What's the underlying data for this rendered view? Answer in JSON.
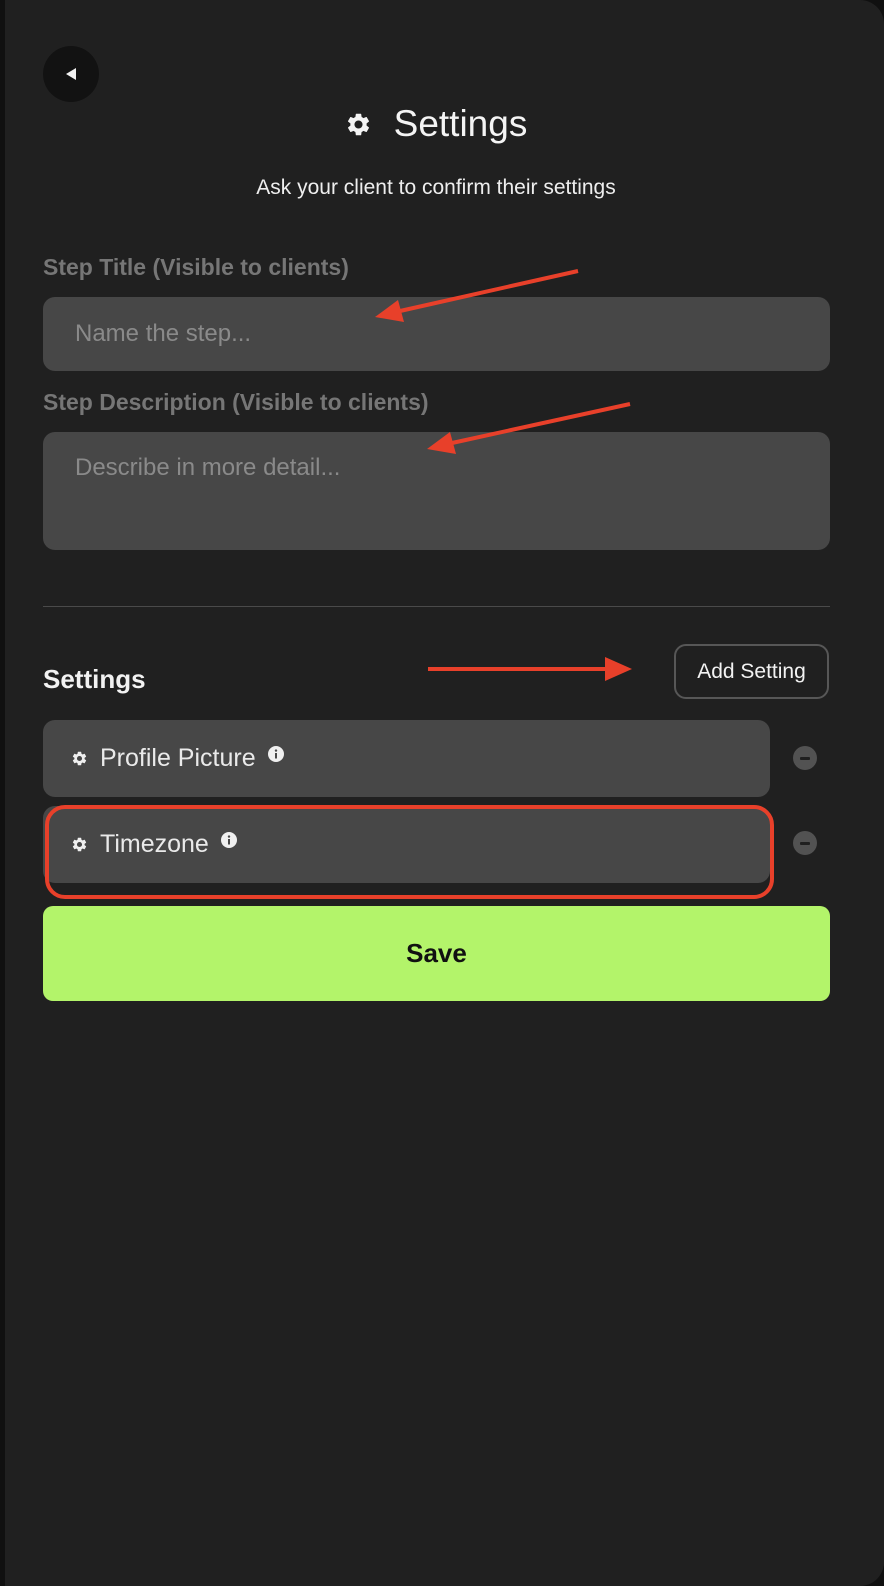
{
  "header": {
    "back_icon": "triangle-left-icon",
    "title_icon": "gear-icon",
    "title": "Settings",
    "subtitle": "Ask your client to confirm their settings"
  },
  "form": {
    "step_title_label": "Step Title (Visible to clients)",
    "step_title_placeholder": "Name the step...",
    "step_title_value": "",
    "step_description_label": "Step Description (Visible to clients)",
    "step_description_placeholder": "Describe in more detail...",
    "step_description_value": ""
  },
  "settings_section": {
    "title": "Settings",
    "add_button_label": "Add Setting",
    "items": [
      {
        "label": "Profile Picture",
        "icon": "gear-icon",
        "info_icon": "info-icon",
        "remove_icon": "minus-circle-icon"
      },
      {
        "label": "Timezone",
        "icon": "gear-icon",
        "info_icon": "info-icon",
        "remove_icon": "minus-circle-icon",
        "highlighted": true
      }
    ]
  },
  "save_button_label": "Save",
  "colors": {
    "panel_background": "#202020",
    "field_background": "#474747",
    "save_button": "#b3f46a",
    "annotation_red": "#e8402a"
  }
}
